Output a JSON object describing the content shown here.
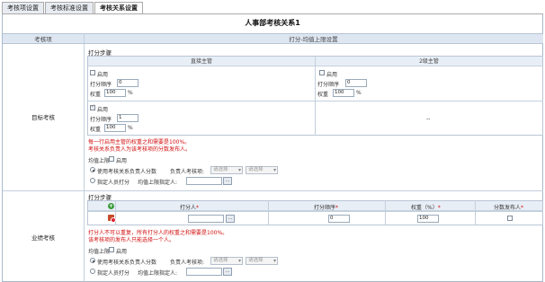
{
  "tabs": [
    "考核项设置",
    "考核标准设置",
    "考核关系设置"
  ],
  "page_title": "人事部考核关系1",
  "header": {
    "col1": "考核项",
    "col2": "打分-均值上限设置"
  },
  "section1": {
    "name": "目标考核",
    "steps_label": "打分步骤",
    "col_left": "直接主管",
    "col_right": "2级主管",
    "enable_label": "启用",
    "order_label": "打分顺序",
    "weight_label": "权重",
    "percent": "%",
    "left": {
      "order": "0",
      "weight": "100"
    },
    "right": {
      "order": "0",
      "weight": "100"
    },
    "lower": {
      "order": "1",
      "weight": "100"
    },
    "empty_cell": "--",
    "warn1": "每一行启用主管的权重之和需要是100%。",
    "warn2": "考核关系负责人为该考核项的分数发布人。",
    "cap_label": "均值上限",
    "cap_enable": "启用",
    "opt1": "使用考核关系负责人分数",
    "opt1_sub": "负责人考核项:",
    "select_placeholder": "请选择",
    "opt2": "指定人员打分",
    "opt2_sub": "均值上限指定人:",
    "btn": "..."
  },
  "section2": {
    "name": "业绩考核",
    "steps_label": "打分步骤",
    "col_scorer": "打分人",
    "col_order": "打分顺序",
    "col_weight": "权重（%）",
    "col_publisher": "分数发布人",
    "row": {
      "order": "0",
      "weight": "100"
    },
    "warn1": "打分人不可以重复，所有打分人的权重之和需要是100%。",
    "warn2": "该考核项的发布人只能选择一个人。",
    "cap_label": "均值上限",
    "cap_enable": "启用",
    "opt1": "使用考核关系负责人分数",
    "opt1_sub": "负责人考核项:",
    "select_placeholder": "请选择",
    "opt2": "指定人员打分",
    "opt2_sub": "均值上限指定人:",
    "btn": "..."
  },
  "icons": [
    "add-icon",
    "delete-icon",
    "checkbox",
    "radio"
  ],
  "colors": {
    "header_bg": "#dde6f1",
    "border": "#a9b9cc",
    "warning": "#d21010"
  }
}
